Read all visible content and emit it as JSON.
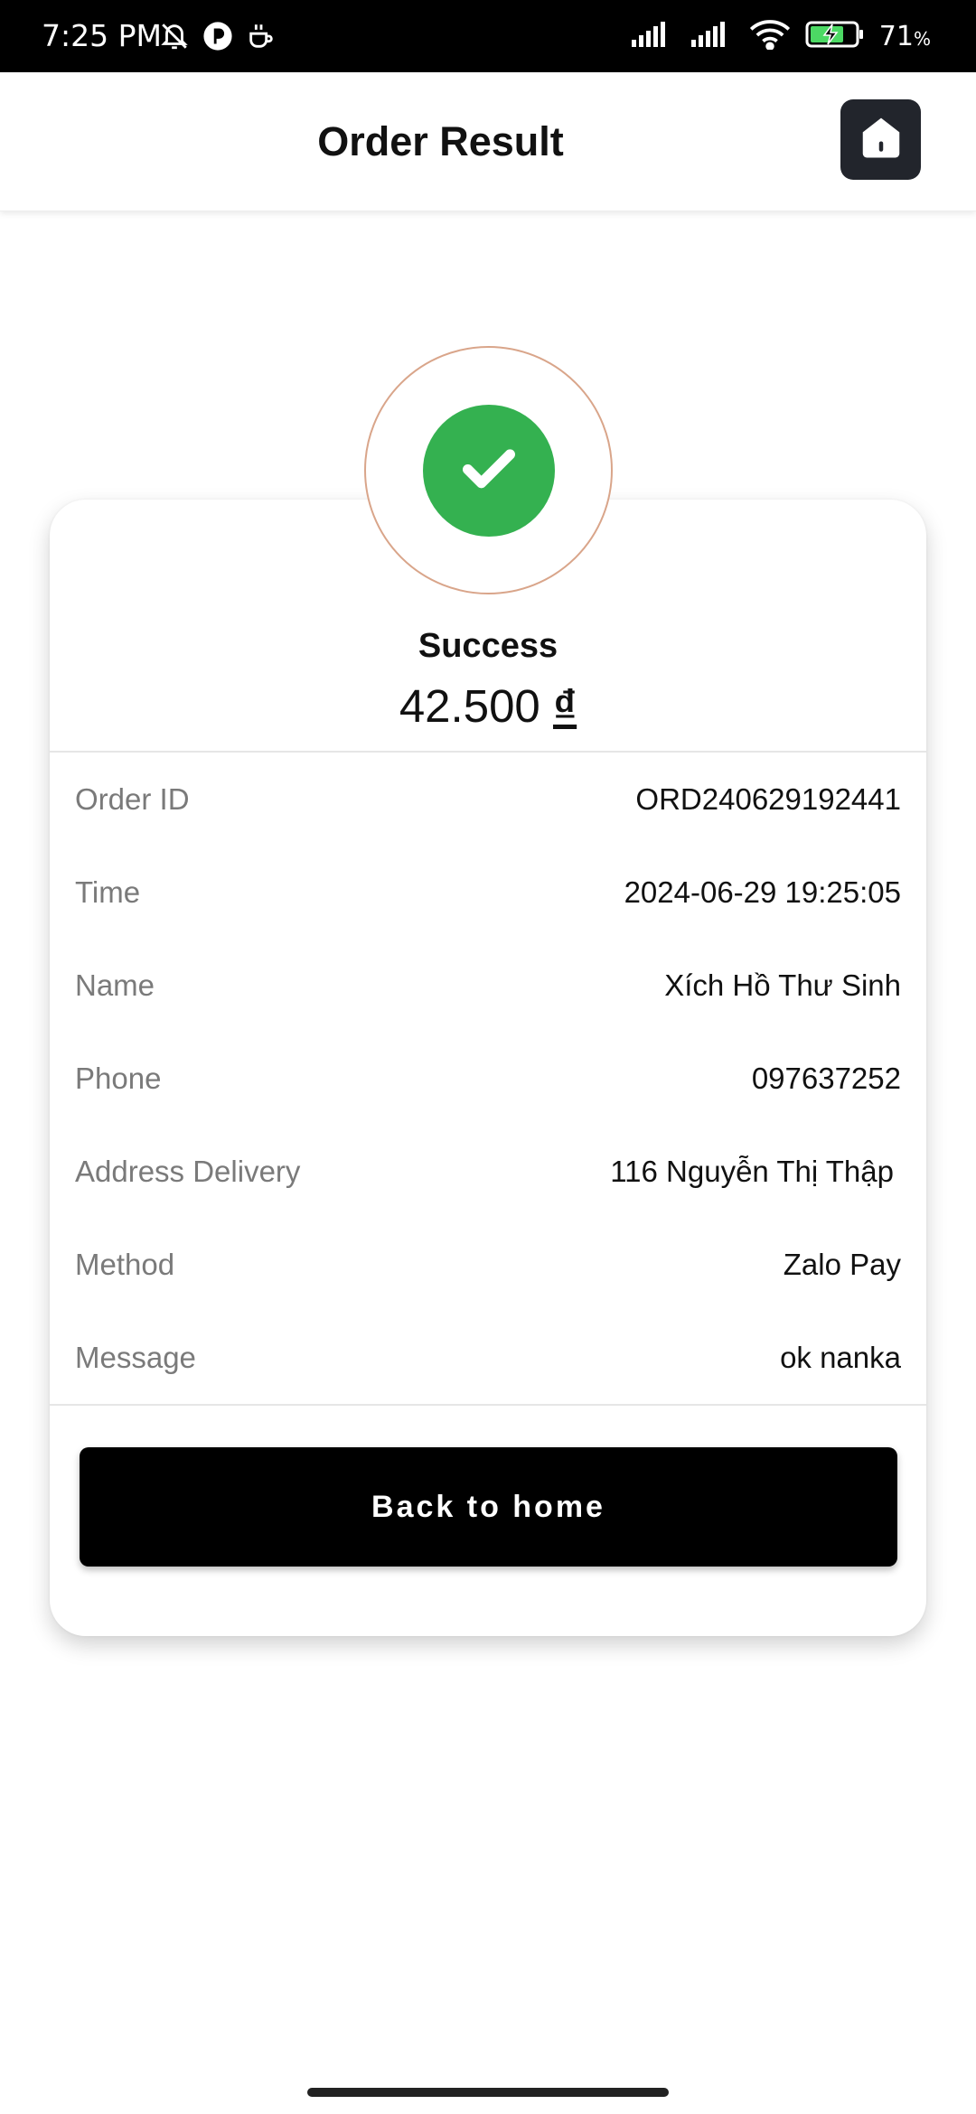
{
  "status_bar": {
    "time": "7:25 PM",
    "battery_level": "71",
    "battery_unit": "%",
    "icons_left": [
      "bell-off-icon",
      "notification-app-icon",
      "coffee-icon"
    ],
    "icons_right": [
      "signal-icon",
      "signal-icon",
      "wifi-icon",
      "battery-charging-icon"
    ]
  },
  "header": {
    "title": "Order Result",
    "home_icon": "home-icon"
  },
  "result": {
    "status": "Success",
    "amount": "42.500",
    "currency": "₫",
    "status_color": "#34b150"
  },
  "details": [
    {
      "label": "Order ID",
      "value": "ORD240629192441"
    },
    {
      "label": "Time",
      "value": "2024-06-29 19:25:05"
    },
    {
      "label": "Name",
      "value": "Xích Hồ Thư Sinh"
    },
    {
      "label": "Phone",
      "value": "097637252"
    },
    {
      "label": "Address Delivery",
      "value": "116 Nguyễn Thị Thập"
    },
    {
      "label": "Method",
      "value": "Zalo Pay"
    },
    {
      "label": "Message",
      "value": "ok nanka"
    }
  ],
  "actions": {
    "back_label": "Back to home"
  }
}
